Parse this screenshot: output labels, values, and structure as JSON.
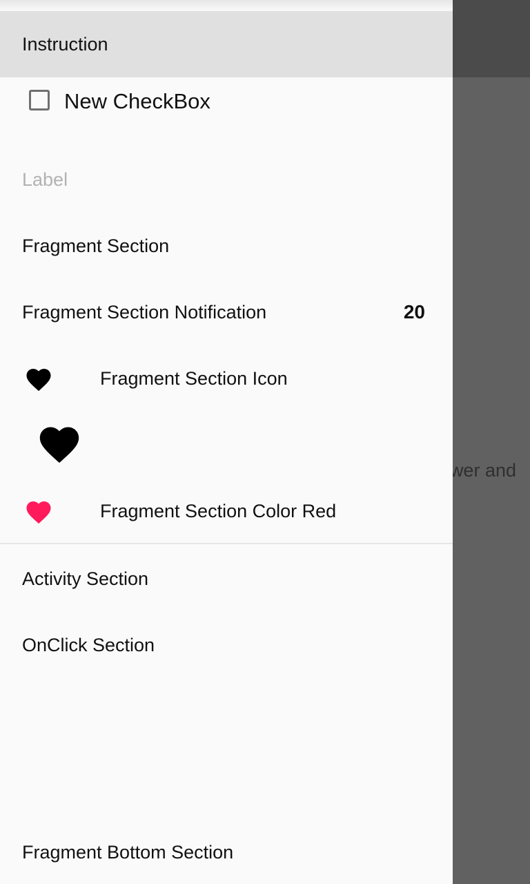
{
  "background": {
    "partial_text": "ower and"
  },
  "drawer": {
    "header": "Instruction",
    "checkbox": {
      "label": "New CheckBox",
      "checked": false
    },
    "label": "Label",
    "items": {
      "fragment_section": "Fragment Section",
      "fragment_notification": {
        "label": "Fragment Section Notification",
        "badge": "20"
      },
      "fragment_icon": {
        "label": "Fragment Section Icon",
        "icon": "heart-icon",
        "color": "#000000"
      },
      "large_icon": {
        "icon": "heart-icon",
        "color": "#000000"
      },
      "fragment_color_red": {
        "label": "Fragment Section Color Red",
        "icon": "heart-icon",
        "color": "#ff1a5c"
      },
      "activity_section": "Activity Section",
      "onclick_section": "OnClick Section",
      "bottom_section": "Fragment Bottom Section"
    }
  }
}
